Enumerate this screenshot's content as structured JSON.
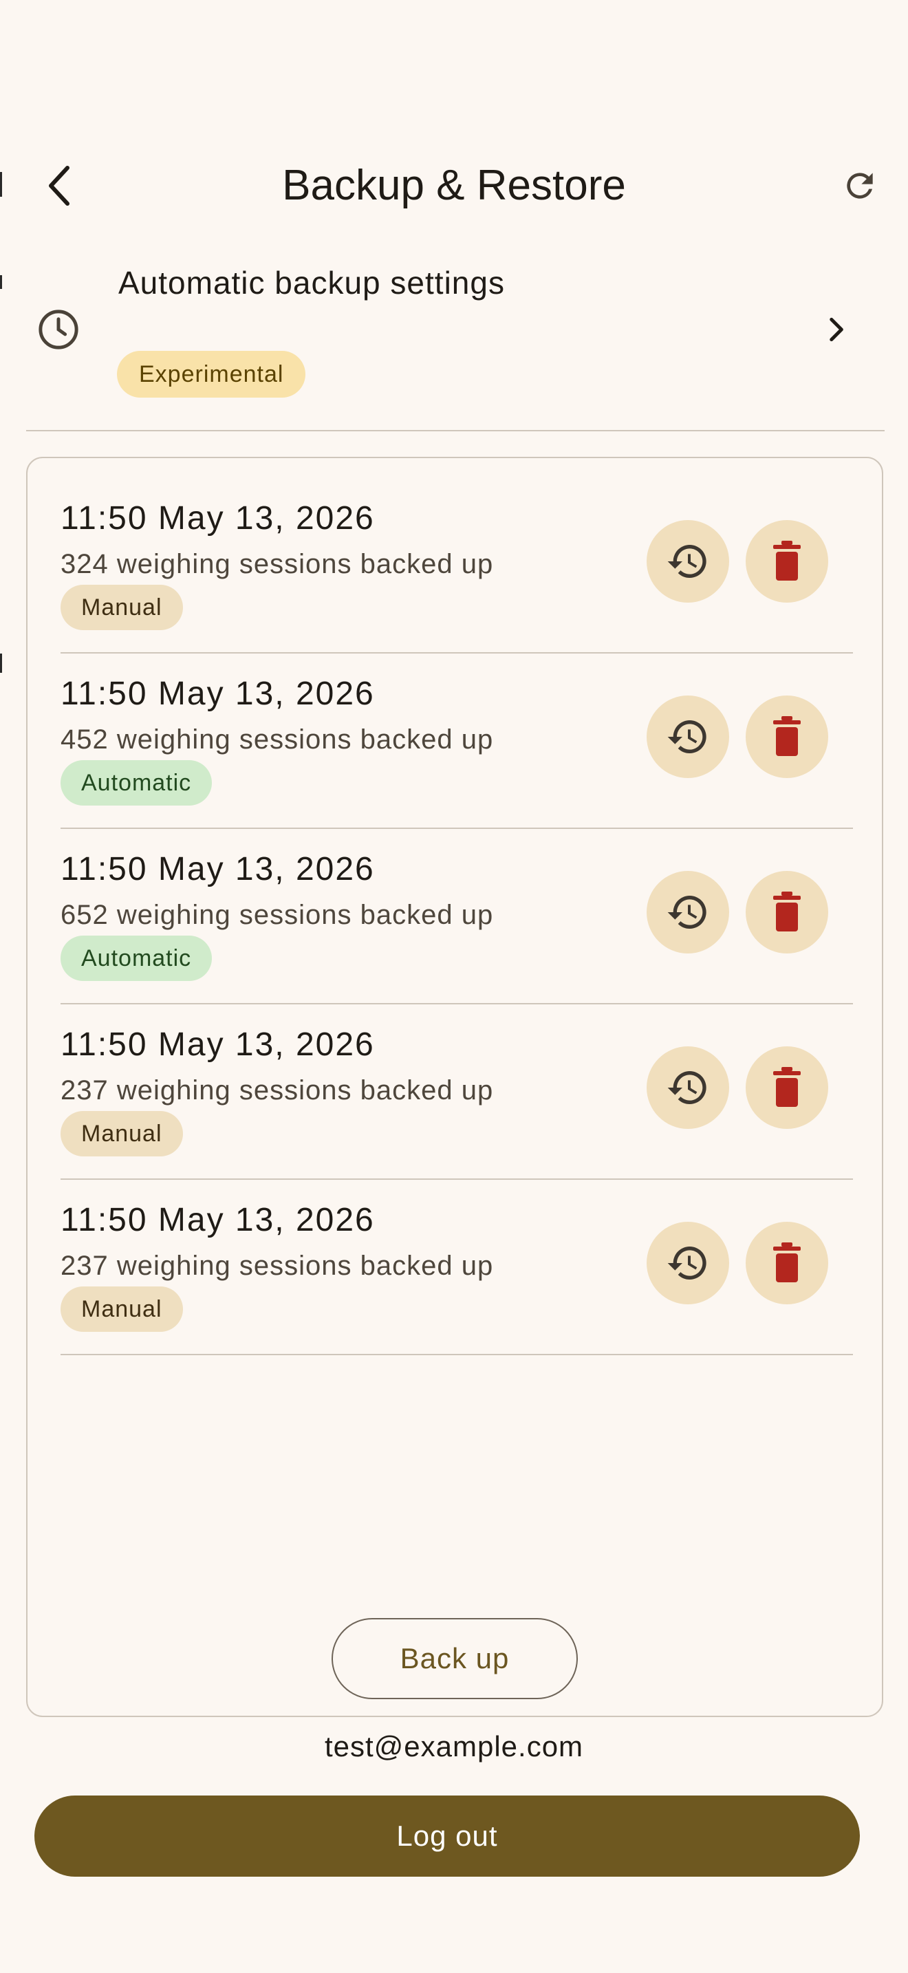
{
  "header": {
    "title": "Backup & Restore",
    "back_icon": "chevron-left-icon",
    "refresh_icon": "refresh-icon"
  },
  "settings": {
    "label": "Automatic backup settings",
    "badge": "Experimental",
    "icon": "clock-icon",
    "chevron_icon": "chevron-right-icon"
  },
  "backups": [
    {
      "time": "11:50 May 13, 2026",
      "description": "324 weighing sessions backed up",
      "type": "Manual"
    },
    {
      "time": "11:50 May 13, 2026",
      "description": "452 weighing sessions backed up",
      "type": "Automatic"
    },
    {
      "time": "11:50 May 13, 2026",
      "description": "652 weighing sessions backed up",
      "type": "Automatic"
    },
    {
      "time": "11:50 May 13, 2026",
      "description": "237 weighing sessions backed up",
      "type": "Manual"
    },
    {
      "time": "11:50 May 13, 2026",
      "description": "237 weighing sessions backed up",
      "type": "Manual"
    }
  ],
  "actions": {
    "backup_label": "Back up",
    "restore_icon": "restore-history-icon",
    "delete_icon": "trash-icon"
  },
  "account": {
    "email": "test@example.com",
    "logout_label": "Log out"
  },
  "colors": {
    "background": "#FCF7F2",
    "primary": "#6E5820",
    "delete": "#B3261E",
    "manual_badge": "#EFDFC0",
    "automatic_badge": "#D0EBCB",
    "experimental_badge": "#F9E2A9"
  }
}
